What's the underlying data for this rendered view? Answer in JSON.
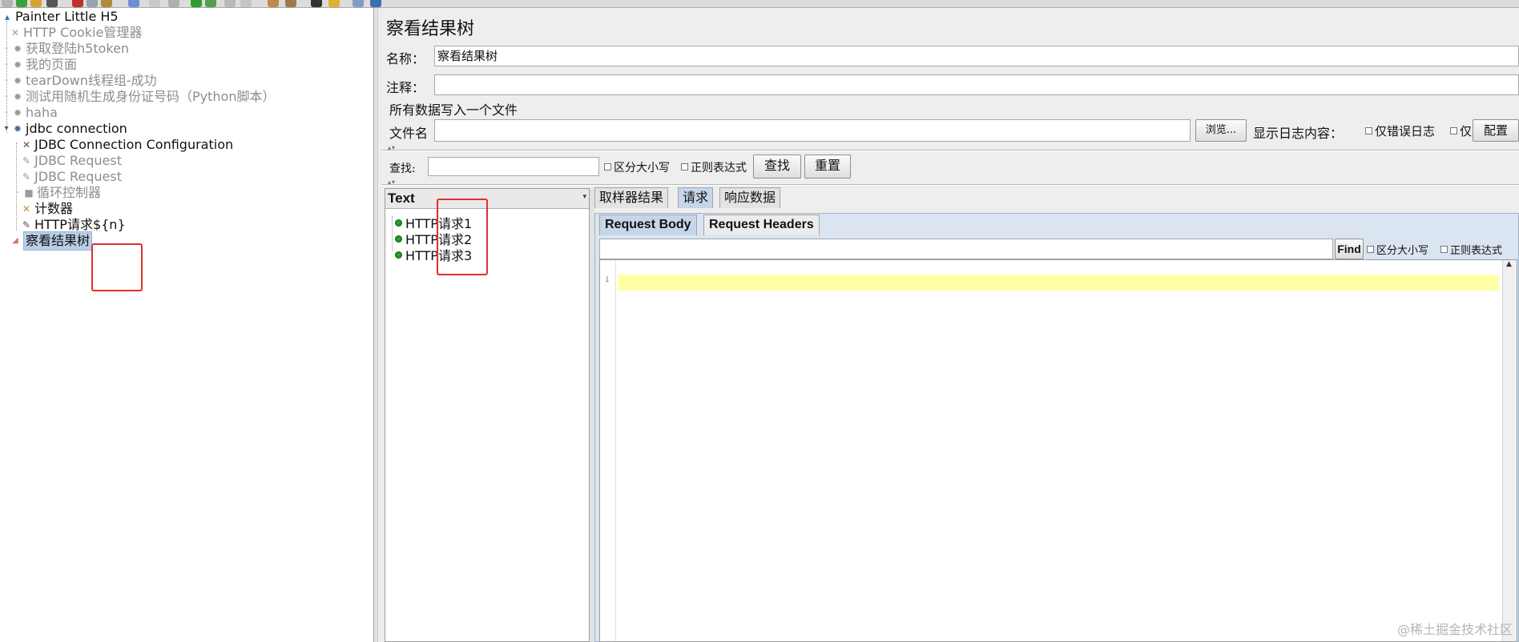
{
  "tree": {
    "root": "Painter Little H5",
    "items": [
      {
        "label": "HTTP Cookie管理器",
        "icon": "cross-tool-icon"
      },
      {
        "label": "获取登陆h5token",
        "icon": "gear-icon"
      },
      {
        "label": "我的页面",
        "icon": "gear-icon"
      },
      {
        "label": "tearDown线程组-成功",
        "icon": "gear-icon"
      },
      {
        "label": "测试用随机生成身份证号码（Python脚本）",
        "icon": "gear-icon"
      },
      {
        "label": "haha",
        "icon": "gear-icon"
      },
      {
        "label": "jdbc connection",
        "icon": "gear-icon"
      },
      {
        "label": "JDBC Connection Configuration",
        "icon": "cross-tool-icon"
      },
      {
        "label": "JDBC Request",
        "icon": "pencil-icon"
      },
      {
        "label": "JDBC Request",
        "icon": "pencil-icon"
      },
      {
        "label": "循环控制器",
        "icon": "square-icon"
      },
      {
        "label": "计数器",
        "icon": "cross-tool-icon"
      },
      {
        "label": "HTTP请求${n}",
        "icon": "pencil-icon"
      },
      {
        "label": "察看结果树",
        "icon": "chart-icon"
      }
    ]
  },
  "panel": {
    "title": "察看结果树",
    "name_label": "名称：",
    "name_value": "察看结果树",
    "comment_label": "注释：",
    "comment_value": "",
    "file_section": "所有数据写入一个文件",
    "filename_label": "文件名",
    "filename_value": "",
    "browse_button": "浏览...",
    "log_label": "显示日志内容：",
    "errors_only": "仅错误日志",
    "success_only": "仅成功日志",
    "config_button": "配置",
    "search_label": "查找:",
    "search_value": "",
    "case_sensitive": "区分大小写",
    "regex": "正则表达式",
    "find_button": "查找",
    "reset_button": "重置"
  },
  "results": {
    "header": "Text",
    "items": [
      "HTTP请求1",
      "HTTP请求2",
      "HTTP请求3"
    ]
  },
  "detail": {
    "tabs": [
      "取样器结果",
      "请求",
      "响应数据"
    ],
    "active_tab": "请求",
    "subtabs": [
      "Request Body",
      "Request Headers"
    ],
    "find_button": "Find",
    "case_sensitive": "区分大小写",
    "regex": "正则表达式",
    "line_number": "1"
  },
  "watermark": "@稀土掘金技术社区",
  "colors": {
    "selection": "#b8cfe5",
    "annotation_red": "#e0302c",
    "highlight_line": "#ffffa8",
    "active_tab": "#c5d6ea"
  }
}
